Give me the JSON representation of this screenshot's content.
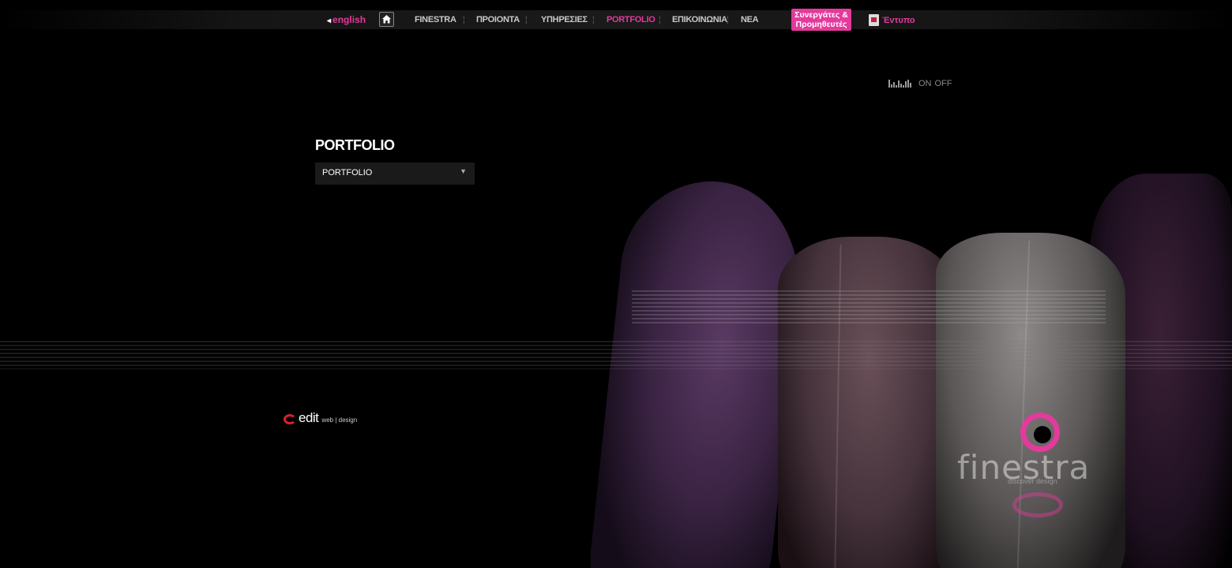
{
  "nav": {
    "language": "english",
    "items": [
      {
        "label": "FINESTRA",
        "active": false
      },
      {
        "label": "ΠΡΟΙΟΝΤΑ",
        "active": false
      },
      {
        "label": "ΥΠΗΡΕΣΙΕΣ",
        "active": false
      },
      {
        "label": "PORTFOLIO",
        "active": true
      },
      {
        "label": "ΕΠΙΚΟΙΝΩΝΙΑ",
        "active": false
      },
      {
        "label": "ΝΕΑ",
        "active": false
      }
    ],
    "partners_line1": "Συνεργάτες &",
    "partners_line2": "Προμηθευτές",
    "brochure": "Έντυπο",
    "home_icon": "home-icon"
  },
  "sound": {
    "on": "ON",
    "off": "OFF"
  },
  "main": {
    "title": "PORTFOLIO",
    "select_value": "PORTFOLIO"
  },
  "footer": {
    "credit_word": "edit",
    "credit_sub": "web | design"
  },
  "brand": {
    "name": "finestra",
    "tagline": "discover design"
  },
  "colors": {
    "accent": "#e33a9c",
    "background": "#000000"
  }
}
